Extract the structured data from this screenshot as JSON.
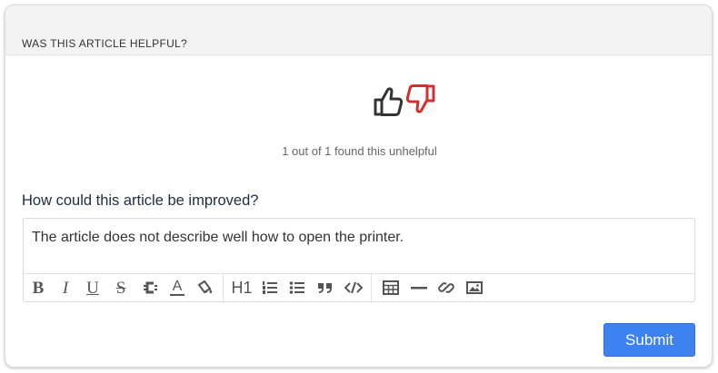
{
  "header": {
    "title": "WAS THIS ARTICLE HELPFUL?"
  },
  "feedback": {
    "summary": "1 out of 1 found this unhelpful",
    "thumb_up_color": "#333333",
    "thumb_down_color": "#d32f2f"
  },
  "improve": {
    "label": "How could this article be improved?",
    "text": "The article does not describe well how to open the printer."
  },
  "toolbar": {
    "bold_glyph": "B",
    "italic_glyph": "I",
    "underline_glyph": "U",
    "strike_glyph": "S",
    "font_color_glyph": "A",
    "heading_glyph": "H1",
    "icons": [
      "bold-icon",
      "italic-icon",
      "underline-icon",
      "strikethrough-icon",
      "clear-format-icon",
      "font-color-icon",
      "highlight-icon",
      "heading-icon",
      "ordered-list-icon",
      "unordered-list-icon",
      "quote-icon",
      "code-icon",
      "table-icon",
      "horizontal-rule-icon",
      "link-icon",
      "image-icon"
    ]
  },
  "actions": {
    "submit_label": "Submit",
    "accent_color": "#3d82ee"
  }
}
